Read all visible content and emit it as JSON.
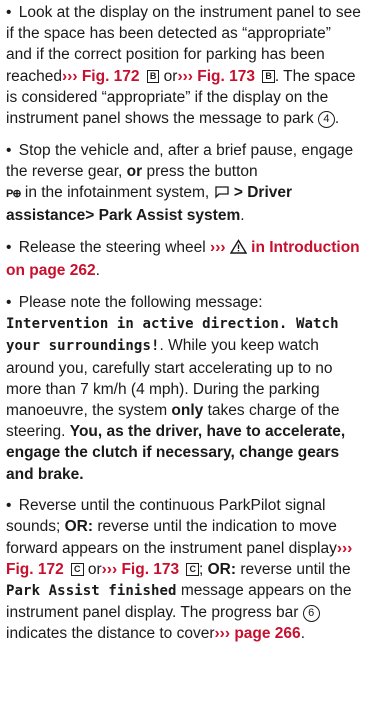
{
  "bullet": "•",
  "fig172": "Fig. 172",
  "fig173": "Fig. 173",
  "arrow": "›››",
  "boxB": "B",
  "boxC": "C",
  "circle4": "4",
  "circle6": "6",
  "p1": {
    "t1": "Look at the display on the instrument panel to see if the space has been detected as “appropriate” and if the correct position for parking has been reached",
    "t2": "or",
    "t3": ". The space is considered “appropriate” if the display on the instrument panel shows the message to park"
  },
  "p2": {
    "t1": "Stop the vehicle and, after a brief pause, engage the reverse gear,",
    "or": "or",
    "t2": "press the button",
    "pglyph": "P⊕",
    "t3": "in the infotainment system,",
    "menu": "> Driver assistance> Park Assist system",
    "end": "."
  },
  "p3": {
    "t1": "Release the steering wheel",
    "link": "in Introduction on page 262",
    "end": "."
  },
  "p4": {
    "t1": "Please note the following message:",
    "mono": "Intervention in active direction. Watch your surroundings!",
    "t2": ". While you keep watch around you, carefully start accelerating up to no more than 7 km/h (4 mph). During the parking manoeuvre, the system",
    "only": "only",
    "t3": "takes charge of the steering.",
    "bold": "You, as the driver, have to accelerate, engage the clutch if necessary, change gears and brake."
  },
  "p5": {
    "t1": "Reverse until the continuous ParkPilot signal sounds;",
    "or1": "OR:",
    "t2": "reverse until the indication to move forward appears on the instrument panel display",
    "t3": "or",
    "or2": "OR:",
    "t4": "reverse until the",
    "mono": "Park Assist finished",
    "t5": "message appears on the instrument panel display. The progress bar",
    "t6": "indicates the distance to cover",
    "page": "page 266",
    "end": "."
  }
}
